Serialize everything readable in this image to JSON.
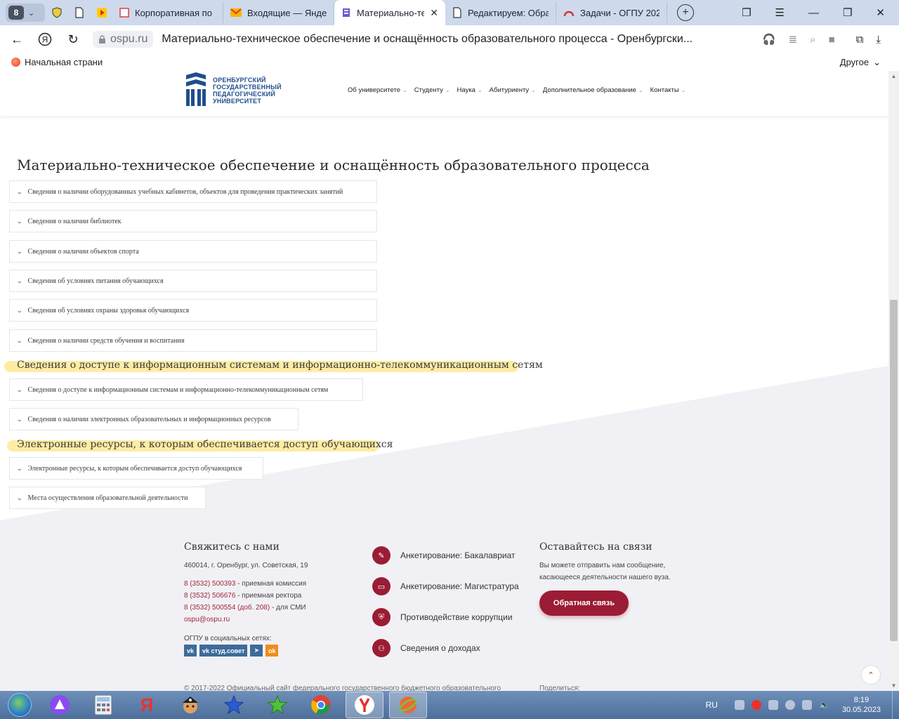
{
  "browser": {
    "tab_count": "8",
    "tabs": [
      {
        "title": "Корпоративная по"
      },
      {
        "title": "Входящие — Яндек"
      },
      {
        "title": "Материально-те"
      },
      {
        "title": "Редактируем: Обра"
      },
      {
        "title": "Задачи - ОГПУ 202"
      }
    ],
    "url_host": "ospu.ru",
    "page_title": "Материально-техническое обеспечение и оснащённость образовательного процесса - Оренбургски...",
    "bookmark_home": "Начальная страни",
    "bookmark_other": "Другое"
  },
  "site": {
    "logo_text": [
      "ОРЕНБУРГСКИЙ",
      "ГОСУДАРСТВЕННЫЙ",
      "ПЕДАГОГИЧЕСКИЙ",
      "УНИВЕРСИТЕТ"
    ],
    "nav": [
      "Об университете",
      "Студенту",
      "Наука",
      "Абитуриенту",
      "Дополнительное образование",
      "Контакты"
    ]
  },
  "content": {
    "title": "Материально-техническое обеспечение и оснащённость образовательного процесса",
    "accordion_1": [
      "Сведения о наличии оборудованных учебных кабинетов, объектов для проведения практических занятий",
      "Сведения о наличии библиотек",
      "Сведения о наличии объектов спорта",
      "Сведения об условиях питания обучающихся",
      "Сведения об условиях охраны здоровья обучающихся",
      "Сведения о наличии средств обучения и воспитания"
    ],
    "section_2_title": "Сведения о доступе к информационным системам и информационно-телекоммуникационным сетям",
    "accordion_2": [
      "Сведения о доступе к информационным системам и информационно-телекоммуникационным сетям",
      "Сведения о наличии электронных образовательных и информационных ресурсов"
    ],
    "section_3_title": "Электронные ресурсы, к которым обеспечивается доступ обучающихся",
    "accordion_3": [
      "Электронные ресурсы, к которым обеспечивается доступ обучающихся",
      "Места осуществления образовательной деятельности"
    ]
  },
  "footer": {
    "contact_title": "Свяжитесь с нами",
    "address": "460014, г. Оренбург, ул. Советская, 19",
    "phones": [
      {
        "num": "8 (3532) 500393",
        "label": " - приемная комиссия"
      },
      {
        "num": "8 (3532) 506676",
        "label": " - приемная ректора"
      },
      {
        "num": "8 (3532) 500554 (доб. 208)",
        "label": " - для СМИ"
      }
    ],
    "email": "ospu@ospu.ru",
    "social_label": "ОГПУ в социальных сетях:",
    "social": {
      "vk": "vk",
      "vk_council": "студ.совет"
    },
    "links": [
      "Анкетирование: Бакалавриат",
      "Анкетирование: Магистратура",
      "Противодействие коррупции",
      "Сведения о доходах"
    ],
    "stay_title": "Оставайтесь на связи",
    "stay_text_1": "Вы можете отправить нам сообщение,",
    "stay_text_2": "касающееся деятельности нашего вуза.",
    "feedback_button": "Обратная связь",
    "copyright": "© 2017-2022 Официальный сайт федерального государственного бюджетного образовательного",
    "share_label": "Поделиться:"
  },
  "taskbar": {
    "lang": "RU",
    "time": "8:19",
    "date": "30.05.2023"
  },
  "colors": {
    "brand": "#9b1c34",
    "logo_blue": "#1f4e8c",
    "highlight": "#ffdd5a"
  }
}
